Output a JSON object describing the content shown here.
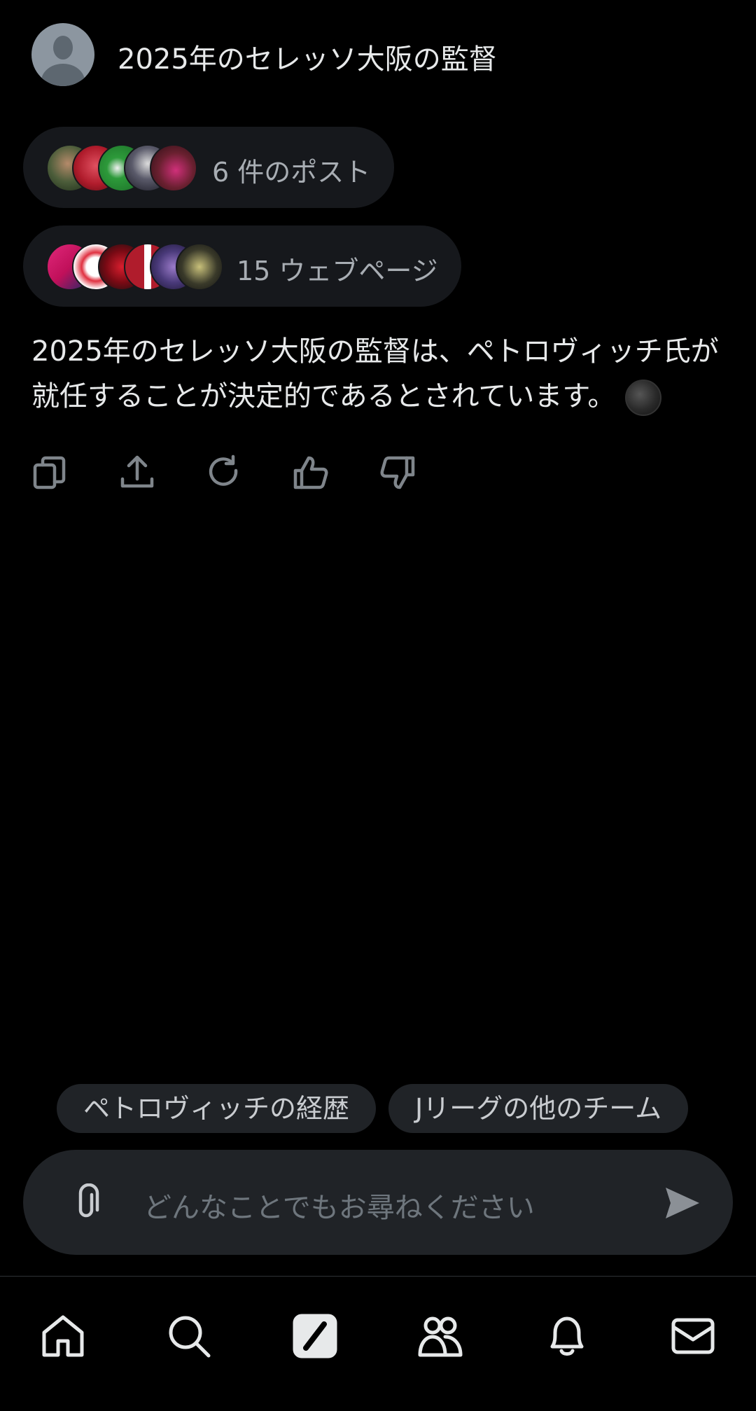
{
  "header": {
    "title": "2025年のセレッソ大阪の監督",
    "avatar_icon": "user-avatar-icon"
  },
  "sources": {
    "posts_label": "6 件のポスト",
    "web_label": "15 ウェブページ"
  },
  "answer": {
    "text": "2025年のセレッソ大阪の監督は、ペトロヴィッチ氏が就任することが決定的であるとされています。"
  },
  "actions": [
    "copy-icon",
    "share-icon",
    "regenerate-icon",
    "thumbs-up-icon",
    "thumbs-down-icon"
  ],
  "suggestions": [
    {
      "label": "ペトロヴィッチの経歴"
    },
    {
      "label": "Jリーグの他のチーム"
    }
  ],
  "composer": {
    "placeholder": "どんなことでもお尋ねください",
    "attach_icon": "paperclip-icon",
    "send_icon": "send-icon"
  },
  "nav": [
    "home-icon",
    "search-icon",
    "grok-icon",
    "communities-icon",
    "notifications-icon",
    "messages-icon"
  ],
  "colors": {
    "background": "#000000",
    "pill": "#16181c",
    "input": "#202327",
    "text": "#e7e9ea",
    "muted": "#a8adb3"
  }
}
